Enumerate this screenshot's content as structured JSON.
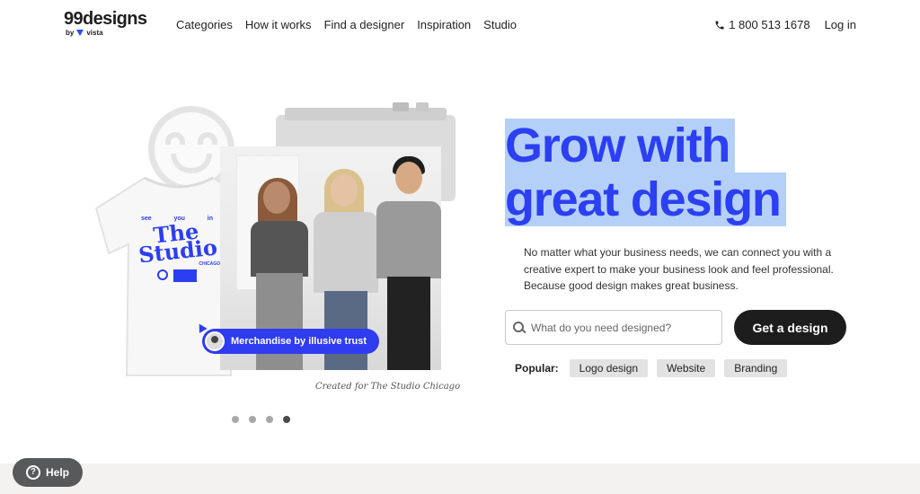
{
  "header": {
    "logo": {
      "main": "99designs",
      "sub": "by",
      "brand": "vista"
    },
    "nav": [
      "Categories",
      "How it works",
      "Find a designer",
      "Inspiration",
      "Studio"
    ],
    "phone": "1 800 513 1678",
    "login": "Log in"
  },
  "hero": {
    "headline_line1": "Grow with",
    "headline_line2": "great design",
    "subtext": "No matter what your business needs, we can connect you with a creative expert to make your business look and feel professional. Because good design makes great business.",
    "search": {
      "placeholder": "What do you need designed?",
      "value": ""
    },
    "cta": "Get a design",
    "popular": {
      "label": "Popular:",
      "tags": [
        "Logo design",
        "Website",
        "Branding"
      ]
    }
  },
  "showcase": {
    "badge": "Merchandise by illusive trust",
    "credit": "Created for The Studio Chicago",
    "shirt_print": {
      "top_left": "see",
      "top_mid": "you",
      "top_right": "in",
      "title": "The Studio",
      "city": "CHICAGO"
    },
    "carousel": {
      "count": 4,
      "active": 4
    }
  },
  "help": {
    "label": "Help",
    "icon": "?"
  },
  "colors": {
    "accent": "#2c3ff2",
    "highlight": "#b4d0f8",
    "cta": "#1d1d1d",
    "help": "#58595b"
  }
}
